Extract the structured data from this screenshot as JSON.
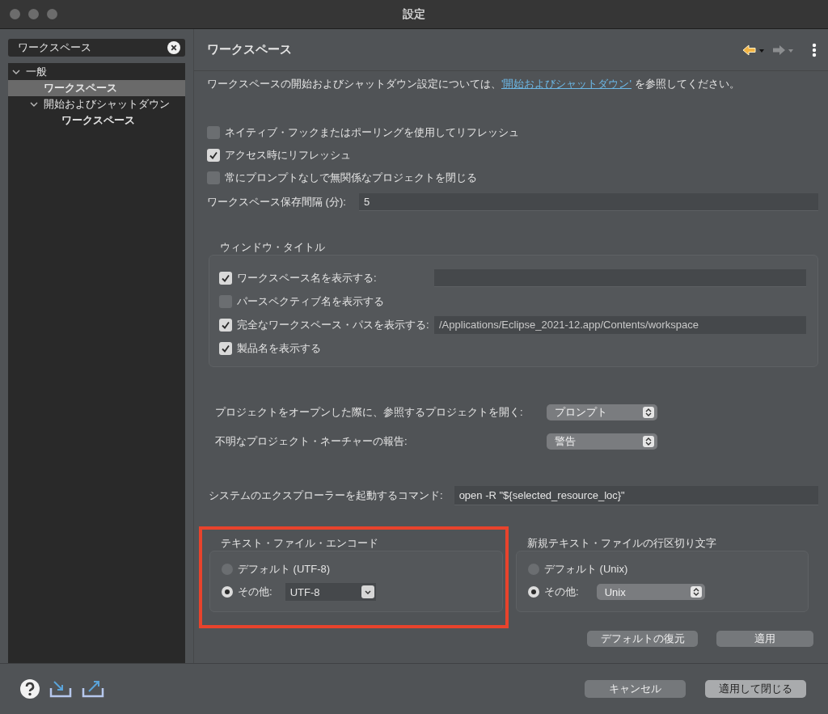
{
  "window": {
    "title": "設定"
  },
  "sidebar": {
    "search": {
      "value": "ワークスペース"
    },
    "tree": [
      {
        "label": "一般",
        "expanded": true,
        "selected": false,
        "matched": false,
        "children": [
          {
            "label": "ワークスペース",
            "selected": true,
            "matched": true
          },
          {
            "label": "開始およびシャットダウン",
            "expanded": true,
            "selected": false,
            "matched": false,
            "children": [
              {
                "label": "ワークスペース",
                "selected": false,
                "matched": true
              }
            ]
          }
        ]
      }
    ]
  },
  "page": {
    "title": "ワークスペース",
    "nav": [
      {
        "kind": "back",
        "disabled": false
      },
      {
        "kind": "forward",
        "disabled": true
      }
    ]
  },
  "intro": {
    "text_before": "ワークスペースの開始およびシャットダウン設定については、",
    "link": "'開始およびシャットダウン'",
    "text_after": " を参照してください。"
  },
  "options": [
    {
      "kind": "checkbox",
      "label": "ネイティブ・フックまたはポーリングを使用してリフレッシュ",
      "checked": false
    },
    {
      "kind": "checkbox",
      "label": "アクセス時にリフレッシュ",
      "checked": true
    },
    {
      "kind": "checkbox",
      "label": "常にプロンプトなしで無関係なプロジェクトを閉じる",
      "checked": false
    },
    {
      "kind": "field",
      "label": "ワークスペース保存間隔 (分):",
      "value": "5"
    }
  ],
  "window_title_group": {
    "title": "ウィンドウ・タイトル",
    "items": [
      {
        "kind": "checkbox_field",
        "label": "ワークスペース名を表示する:",
        "checked": true
      },
      {
        "kind": "checkbox",
        "label": "パースペクティブ名を表示する",
        "checked": false
      },
      {
        "kind": "checkbox_field",
        "label": "完全なワークスペース・パスを表示する:",
        "checked": true,
        "value": "/Applications/Eclipse_2021-12.app/Contents/workspace"
      },
      {
        "kind": "checkbox",
        "label": "製品名を表示する",
        "checked": true
      }
    ]
  },
  "selects": [
    {
      "label": "プロジェクトをオープンした際に、参照するプロジェクトを開く:",
      "value": "プロンプト"
    },
    {
      "label": "不明なプロジェクト・ネーチャーの報告:",
      "value": "警告"
    }
  ],
  "command": {
    "label": "システムのエクスプローラーを起動するコマンド:",
    "value": "open -R \"${selected_resource_loc}\""
  },
  "groups": [
    {
      "title": "テキスト・ファイル・エンコード",
      "highlighted": true,
      "options": [
        {
          "kind": "radio",
          "label": "デフォルト (UTF-8)",
          "selected": false
        },
        {
          "kind": "radio_combo",
          "label": "その他:",
          "selected": true,
          "value": "UTF-8"
        }
      ]
    },
    {
      "title": "新規テキスト・ファイルの行区切り文字",
      "highlighted": false,
      "options": [
        {
          "kind": "radio",
          "label": "デフォルト (Unix)",
          "selected": false
        },
        {
          "kind": "radio_select",
          "label": "その他:",
          "selected": true,
          "value": "Unix"
        }
      ]
    }
  ],
  "page_buttons": [
    "デフォルトの復元",
    "適用"
  ],
  "footer": {
    "buttons": [
      {
        "label": "キャンセル",
        "default": false
      },
      {
        "label": "適用して閉じる",
        "default": true
      }
    ]
  }
}
